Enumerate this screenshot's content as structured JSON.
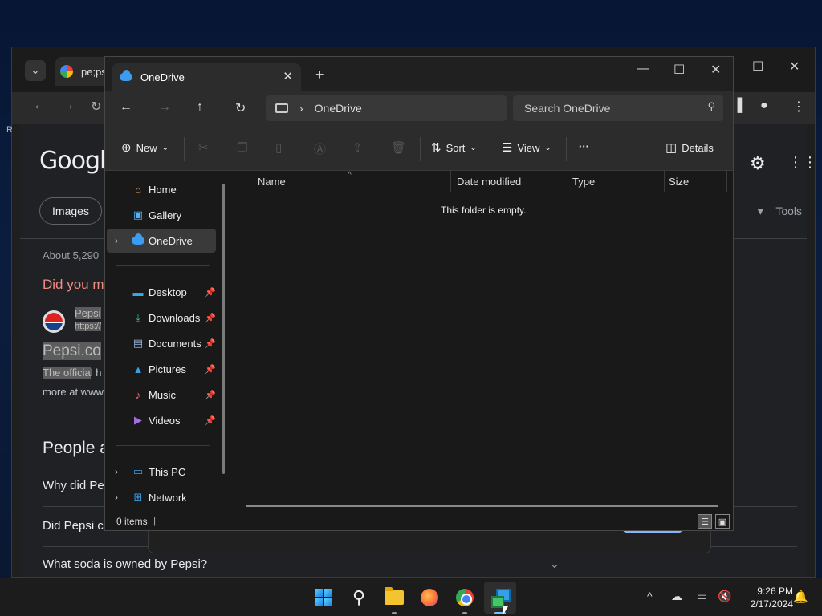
{
  "chrome": {
    "tab_title": "pe;psi",
    "logo_text": "Google",
    "images_label": "Images",
    "tools_label": "Tools",
    "results_about": "About 5,290",
    "did_you_mean": "Did you m",
    "result_site": "Pepsi",
    "result_url": "https://",
    "result_title": "Pepsi.co",
    "result_snippet_hl": "The officia",
    "result_snippet_rest": "l h",
    "result_more": "more at www",
    "paa_heading": "People a",
    "questions": [
      "Why did Pe",
      "Did Pepsi c",
      "What soda is owned by Pepsi?"
    ],
    "left_letter": "R"
  },
  "explorer": {
    "tab_title": "OneDrive",
    "address_segment": "OneDrive",
    "search_placeholder": "Search OneDrive",
    "commands": {
      "new_label": "New",
      "sort_label": "Sort",
      "view_label": "View",
      "more_label": "···",
      "details_label": "Details"
    },
    "nav": {
      "home": "Home",
      "gallery": "Gallery",
      "onedrive": "OneDrive",
      "desktop": "Desktop",
      "downloads": "Downloads",
      "documents": "Documents",
      "pictures": "Pictures",
      "music": "Music",
      "videos": "Videos",
      "this_pc": "This PC",
      "network": "Network"
    },
    "columns": {
      "name": "Name",
      "date_modified": "Date modified",
      "type": "Type",
      "size": "Size"
    },
    "empty_message": "This folder is empty.",
    "status_items": "0 items"
  },
  "taskbar": {
    "time": "9:26 PM",
    "date": "2/17/2024"
  },
  "colors": {
    "accent": "#3b9cf2",
    "explorer_bg": "#191919",
    "chrome_bg": "#202124"
  }
}
